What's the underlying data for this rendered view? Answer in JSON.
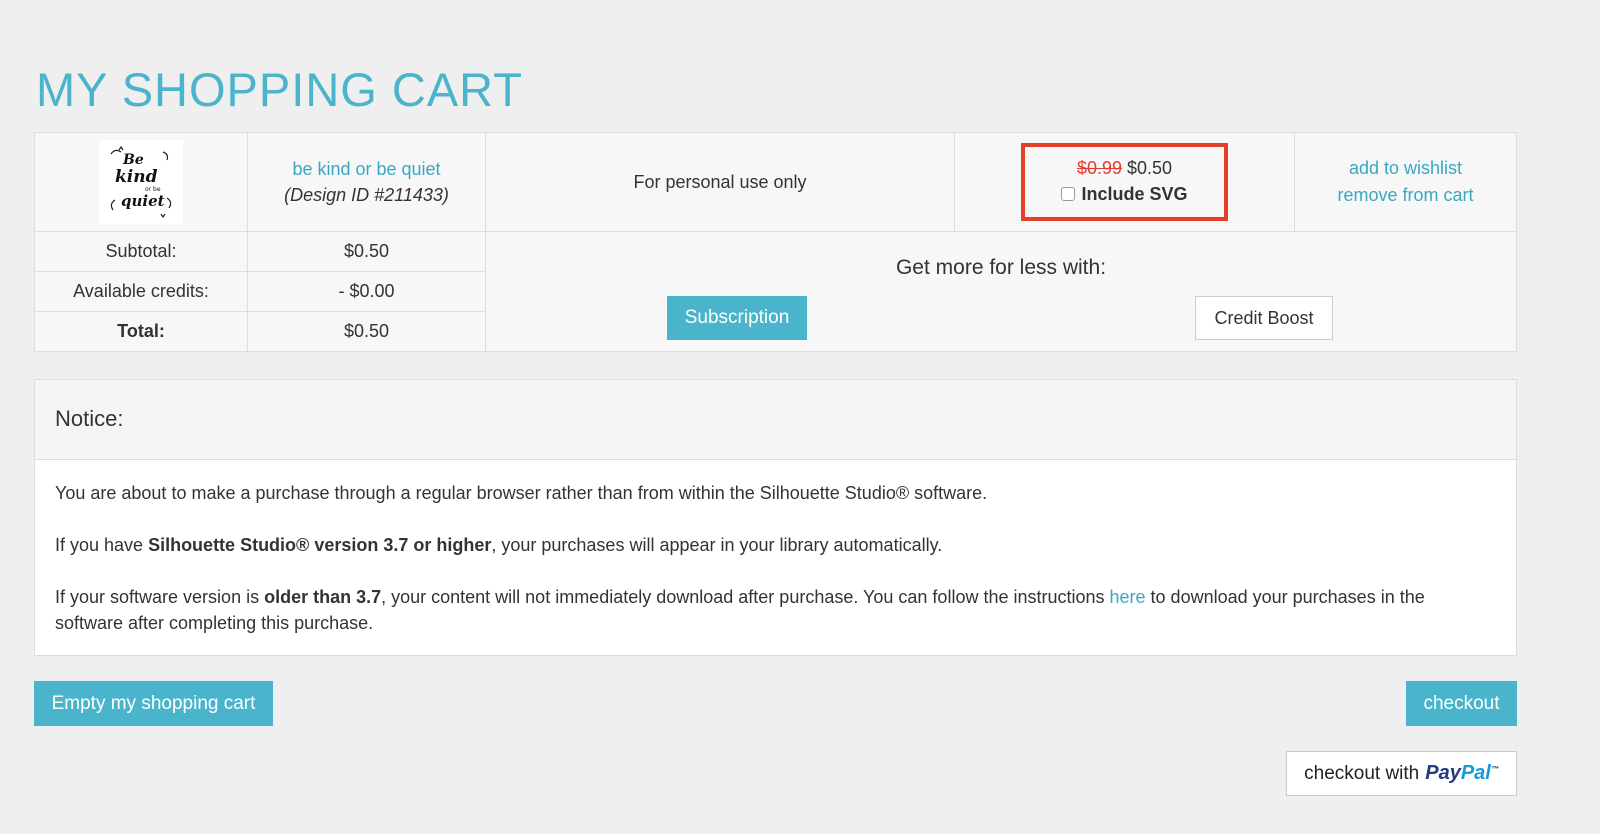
{
  "page": {
    "title": "MY SHOPPING CART"
  },
  "item": {
    "name": "be kind or be quiet",
    "design_id": "(Design ID #211433)",
    "license": "For personal use only",
    "original_price": "$0.99",
    "price": "$0.50",
    "svg_option_label": "Include SVG",
    "svg_option_checked": false,
    "wishlist_label": "add to wishlist",
    "remove_label": "remove from cart",
    "thumbnail": {
      "icon": "lettering-design-thumbnail",
      "text_line1": "Be",
      "text_line2": "kind",
      "text_line3": "or be",
      "text_line4": "quiet"
    }
  },
  "summary": {
    "subtotal_label": "Subtotal:",
    "subtotal_value": "$0.50",
    "credits_label": "Available credits:",
    "credits_value": "- $0.00",
    "total_label": "Total:",
    "total_value": "$0.50"
  },
  "promo": {
    "title": "Get more for less with:",
    "subscription_label": "Subscription",
    "credit_boost_label": "Credit Boost"
  },
  "notice": {
    "title": "Notice:",
    "p1": "You are about to make a purchase through a regular browser rather than from within the Silhouette Studio® software.",
    "p2_pre": "If you have ",
    "p2_bold": "Silhouette Studio® version 3.7 or higher",
    "p2_post": ", your purchases will appear in your library automatically.",
    "p3_pre": "If your software version is ",
    "p3_bold": "older than 3.7",
    "p3_mid": ", your content will not immediately download after purchase. You can follow the instructions ",
    "p3_link": "here",
    "p3_post": " to download your purchases in the software after completing this purchase."
  },
  "actions": {
    "empty_cart_label": "Empty my shopping cart",
    "checkout_label": "checkout",
    "paypal_prefix": "checkout with",
    "paypal_brand_a": "Pay",
    "paypal_brand_b": "Pal",
    "paypal_tm": "™"
  },
  "colors": {
    "accent": "#4bb4cd",
    "link": "#3aa7c2",
    "highlight_border": "#e3402c",
    "strike_price": "#e33b2e"
  }
}
